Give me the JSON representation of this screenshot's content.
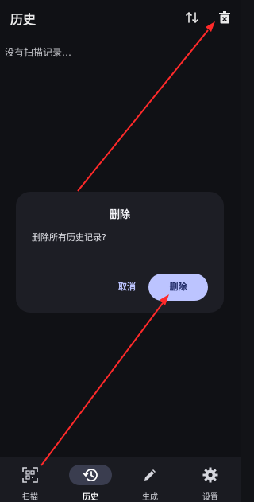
{
  "header": {
    "title": "历史"
  },
  "empty_message": "没有扫描记录…",
  "icons": {
    "sort": "swap-vertical-icon",
    "delete": "trash-icon"
  },
  "dialog": {
    "title": "删除",
    "message": "删除所有历史记录?",
    "cancel_label": "取消",
    "confirm_label": "删除"
  },
  "nav": {
    "items": [
      {
        "label": "扫描",
        "icon": "scan-icon",
        "active": false
      },
      {
        "label": "历史",
        "icon": "history-icon",
        "active": true
      },
      {
        "label": "生成",
        "icon": "pencil-icon",
        "active": false
      },
      {
        "label": "设置",
        "icon": "gear-icon",
        "active": false
      }
    ]
  },
  "colors": {
    "background": "#121317",
    "dialog": "#1d1e25",
    "accent": "#bcc4ff",
    "annotation": "#ff2a2a"
  }
}
